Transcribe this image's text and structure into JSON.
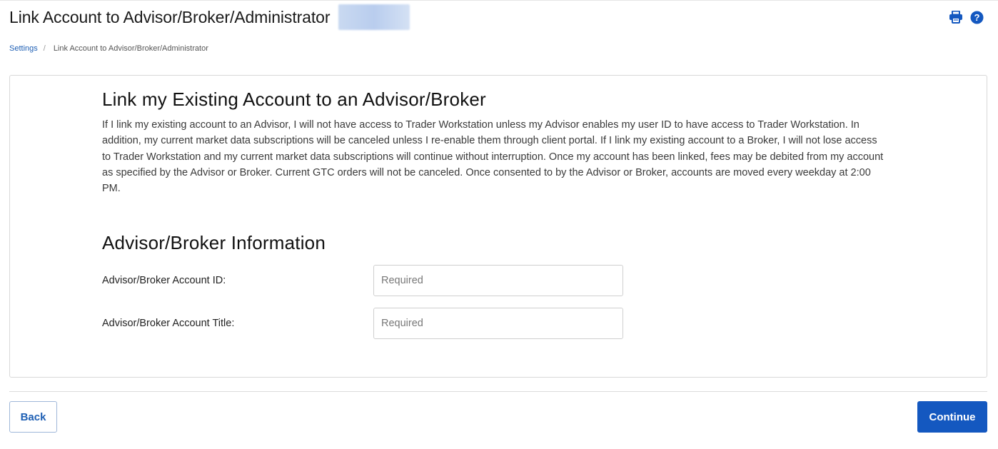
{
  "header": {
    "title": "Link Account to Advisor/Broker/Administrator",
    "print_icon": "print-icon",
    "help_icon": "help-icon",
    "accent_color": "#1458c0"
  },
  "breadcrumb": {
    "items": [
      "Settings",
      "Link Account to Advisor/Broker/Administrator"
    ],
    "separator": "/"
  },
  "main": {
    "section1_title": "Link my Existing Account to an Advisor/Broker",
    "section1_body": "If I link my existing account to an Advisor, I will not have access to Trader Workstation unless my Advisor enables my user ID to have access to Trader Workstation. In addition, my current market data subscriptions will be canceled unless I re-enable them through client portal. If I link my existing account to a Broker, I will not lose access to Trader Workstation and my current market data subscriptions will continue without interruption. Once my account has been linked, fees may be debited from my account as specified by the Advisor or Broker. Current GTC orders will not be canceled. Once consented to by the Advisor or Broker, accounts are moved every weekday at 2:00 PM.",
    "section2_title": "Advisor/Broker Information",
    "form": {
      "account_id_label": "Advisor/Broker Account ID:",
      "account_id_placeholder": "Required",
      "account_id_value": "",
      "account_title_label": "Advisor/Broker Account Title:",
      "account_title_placeholder": "Required",
      "account_title_value": ""
    }
  },
  "footer": {
    "back_label": "Back",
    "continue_label": "Continue"
  }
}
